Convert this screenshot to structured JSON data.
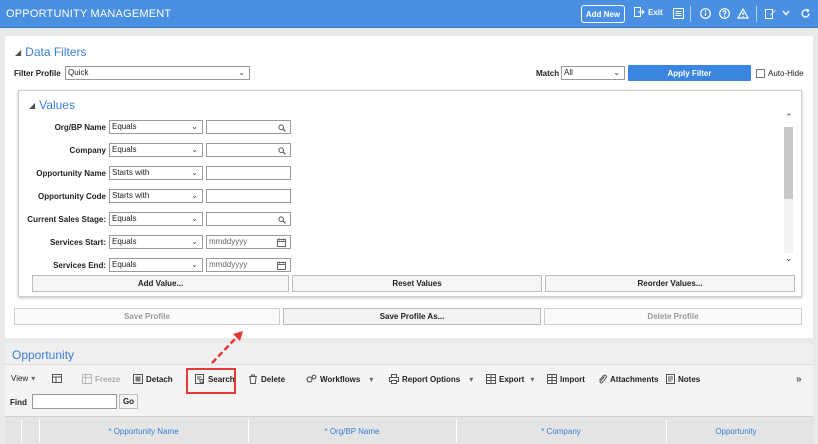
{
  "titlebar": {
    "title": "OPPORTUNITY MANAGEMENT",
    "add_new": "Add New",
    "exit": "Exit",
    "icons": [
      "list-icon",
      "info-icon",
      "help-icon",
      "warning-icon",
      "edit-icon",
      "refresh-icon"
    ]
  },
  "filters": {
    "heading": "Data Filters",
    "profile_label": "Filter Profile",
    "profile_value": "Quick",
    "match_label": "Match",
    "match_value": "All",
    "apply_label": "Apply Filter",
    "autohide_label": "Auto-Hide"
  },
  "values": {
    "heading": "Values",
    "rows": [
      {
        "label": "Org/BP Name",
        "operator": "Equals",
        "value": "",
        "kind": "lookup"
      },
      {
        "label": "Company",
        "operator": "Equals",
        "value": "",
        "kind": "lookup"
      },
      {
        "label": "Opportunity Name",
        "operator": "Starts with",
        "value": "",
        "kind": "text"
      },
      {
        "label": "Opportunity Code",
        "operator": "Starts with",
        "value": "",
        "kind": "text"
      },
      {
        "label": "Current Sales Stage:",
        "operator": "Equals",
        "value": "",
        "kind": "lookup"
      },
      {
        "label": "Services Start:",
        "operator": "Equals",
        "value": "mmddyyyy",
        "kind": "date"
      },
      {
        "label": "Services End:",
        "operator": "Equals",
        "value": "mmddyyyy",
        "kind": "date"
      }
    ],
    "add_value": "Add Value...",
    "reset_values": "Reset Values",
    "reorder_values": "Reorder Values..."
  },
  "profile_buttons": {
    "save": "Save Profile",
    "save_as": "Save Profile As...",
    "delete": "Delete Profile"
  },
  "opportunity": {
    "heading": "Opportunity",
    "toolbar": {
      "view": "View",
      "freeze": "Freeze",
      "detach": "Detach",
      "search": "Search",
      "delete": "Delete",
      "workflows": "Workflows",
      "report_options": "Report Options",
      "export": "Export",
      "import": "Import",
      "attachments": "Attachments",
      "notes": "Notes",
      "more": "»"
    },
    "find_label": "Find",
    "go_label": "Go",
    "columns": [
      "* Opportunity Name",
      "* Org/BP Name",
      "* Company",
      "Opportunity"
    ]
  },
  "colors": {
    "titlebar": "#4a90e2",
    "accent": "#3a7fd5",
    "highlight": "#e53935"
  }
}
